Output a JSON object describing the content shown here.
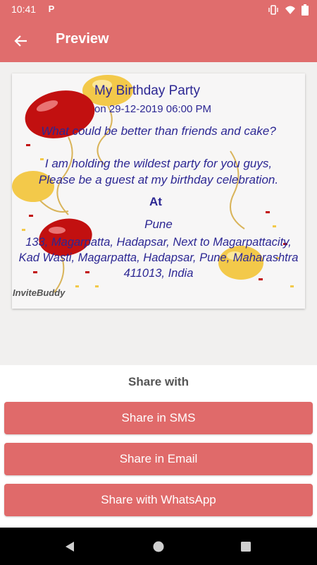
{
  "status": {
    "time": "10:41"
  },
  "appbar": {
    "title": "Preview"
  },
  "invitation": {
    "title": "My Birthday Party",
    "date": "on 29-12-2019 06:00 PM",
    "message": "What could be better than friends and cake?\n\nI am holding the wildest party for you guys,\nPlease be a guest at my birthday celebration.",
    "at_label": "At",
    "city": "Pune",
    "address": "133, Magarpatta, Hadapsar, Next to Magarpattacity, Kad Wasti, Magarpatta, Hadapsar, Pune, Maharashtra 411013, India",
    "brand": "InviteBuddy"
  },
  "share": {
    "heading": "Share with",
    "sms": "Share in SMS",
    "email": "Share in Email",
    "whatsapp": "Share with WhatsApp"
  },
  "colors": {
    "accent": "#e06d6d",
    "invite_text": "#2c2793"
  }
}
